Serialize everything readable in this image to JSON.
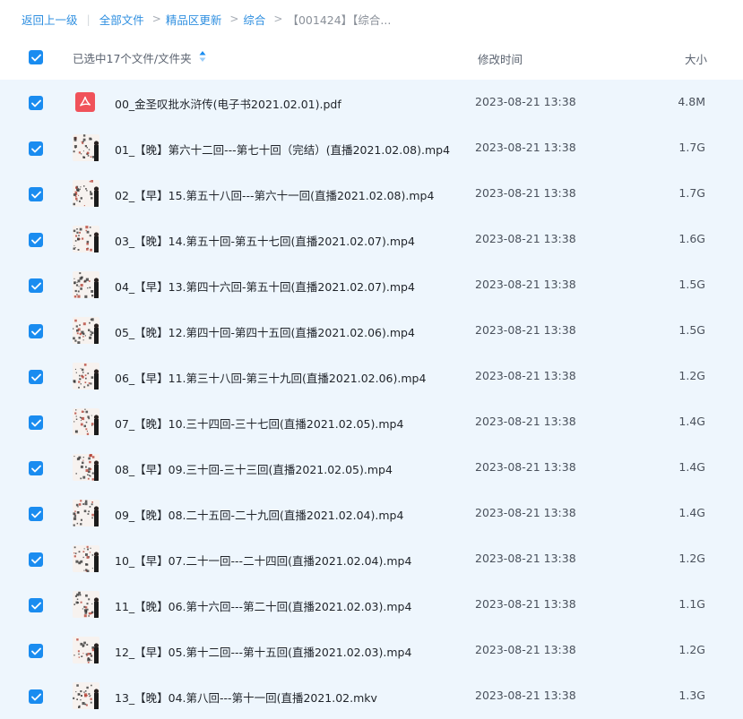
{
  "breadcrumb": {
    "back": "返回上一级",
    "all_files": "全部文件",
    "premium": "精品区更新",
    "category": "综合",
    "current": "【001424】【综合..."
  },
  "header": {
    "selection_label": "已选中17个文件/文件夹",
    "time_label": "修改时间",
    "size_label": "大小"
  },
  "colors": {
    "accent": "#1a8cf0",
    "row_selected_bg": "#eef6fd",
    "pdf_red": "#f0525a"
  },
  "files": [
    {
      "name": "00_金圣叹批水浒传(电子书2021.02.01).pdf",
      "time": "2023-08-21 13:38",
      "size": "4.8M",
      "type": "pdf",
      "icon": "pdf-icon"
    },
    {
      "name": "01_【晚】第六十二回---第七十回（完结）(直播2021.02.08).mp4",
      "time": "2023-08-21 13:38",
      "size": "1.7G",
      "type": "video",
      "icon": "video-thumbnail"
    },
    {
      "name": "02_【早】15.第五十八回---第六十一回(直播2021.02.08).mp4",
      "time": "2023-08-21 13:38",
      "size": "1.7G",
      "type": "video",
      "icon": "video-thumbnail"
    },
    {
      "name": "03_【晚】14.第五十回-第五十七回(直播2021.02.07).mp4",
      "time": "2023-08-21 13:38",
      "size": "1.6G",
      "type": "video",
      "icon": "video-thumbnail"
    },
    {
      "name": "04_【早】13.第四十六回-第五十回(直播2021.02.07).mp4",
      "time": "2023-08-21 13:38",
      "size": "1.5G",
      "type": "video",
      "icon": "video-thumbnail"
    },
    {
      "name": "05_【晚】12.第四十回-第四十五回(直播2021.02.06).mp4",
      "time": "2023-08-21 13:38",
      "size": "1.5G",
      "type": "video",
      "icon": "video-thumbnail"
    },
    {
      "name": "06_【早】11.第三十八回-第三十九回(直播2021.02.06).mp4",
      "time": "2023-08-21 13:38",
      "size": "1.2G",
      "type": "video",
      "icon": "video-thumbnail"
    },
    {
      "name": "07_【晚】10.三十四回-三十七回(直播2021.02.05).mp4",
      "time": "2023-08-21 13:38",
      "size": "1.4G",
      "type": "video",
      "icon": "video-thumbnail"
    },
    {
      "name": "08_【早】09.三十回-三十三回(直播2021.02.05).mp4",
      "time": "2023-08-21 13:38",
      "size": "1.4G",
      "type": "video",
      "icon": "video-thumbnail"
    },
    {
      "name": "09_【晚】08.二十五回-二十九回(直播2021.02.04).mp4",
      "time": "2023-08-21 13:38",
      "size": "1.4G",
      "type": "video",
      "icon": "video-thumbnail"
    },
    {
      "name": "10_【早】07.二十一回---二十四回(直播2021.02.04).mp4",
      "time": "2023-08-21 13:38",
      "size": "1.2G",
      "type": "video",
      "icon": "video-thumbnail"
    },
    {
      "name": "11_【晚】06.第十六回---第二十回(直播2021.02.03).mp4",
      "time": "2023-08-21 13:38",
      "size": "1.1G",
      "type": "video",
      "icon": "video-thumbnail"
    },
    {
      "name": "12_【早】05.第十二回---第十五回(直播2021.02.03).mp4",
      "time": "2023-08-21 13:38",
      "size": "1.2G",
      "type": "video",
      "icon": "video-thumbnail"
    },
    {
      "name": "13_【晚】04.第八回---第十一回(直播2021.02.mkv",
      "time": "2023-08-21 13:38",
      "size": "1.3G",
      "type": "video",
      "icon": "video-thumbnail"
    }
  ]
}
